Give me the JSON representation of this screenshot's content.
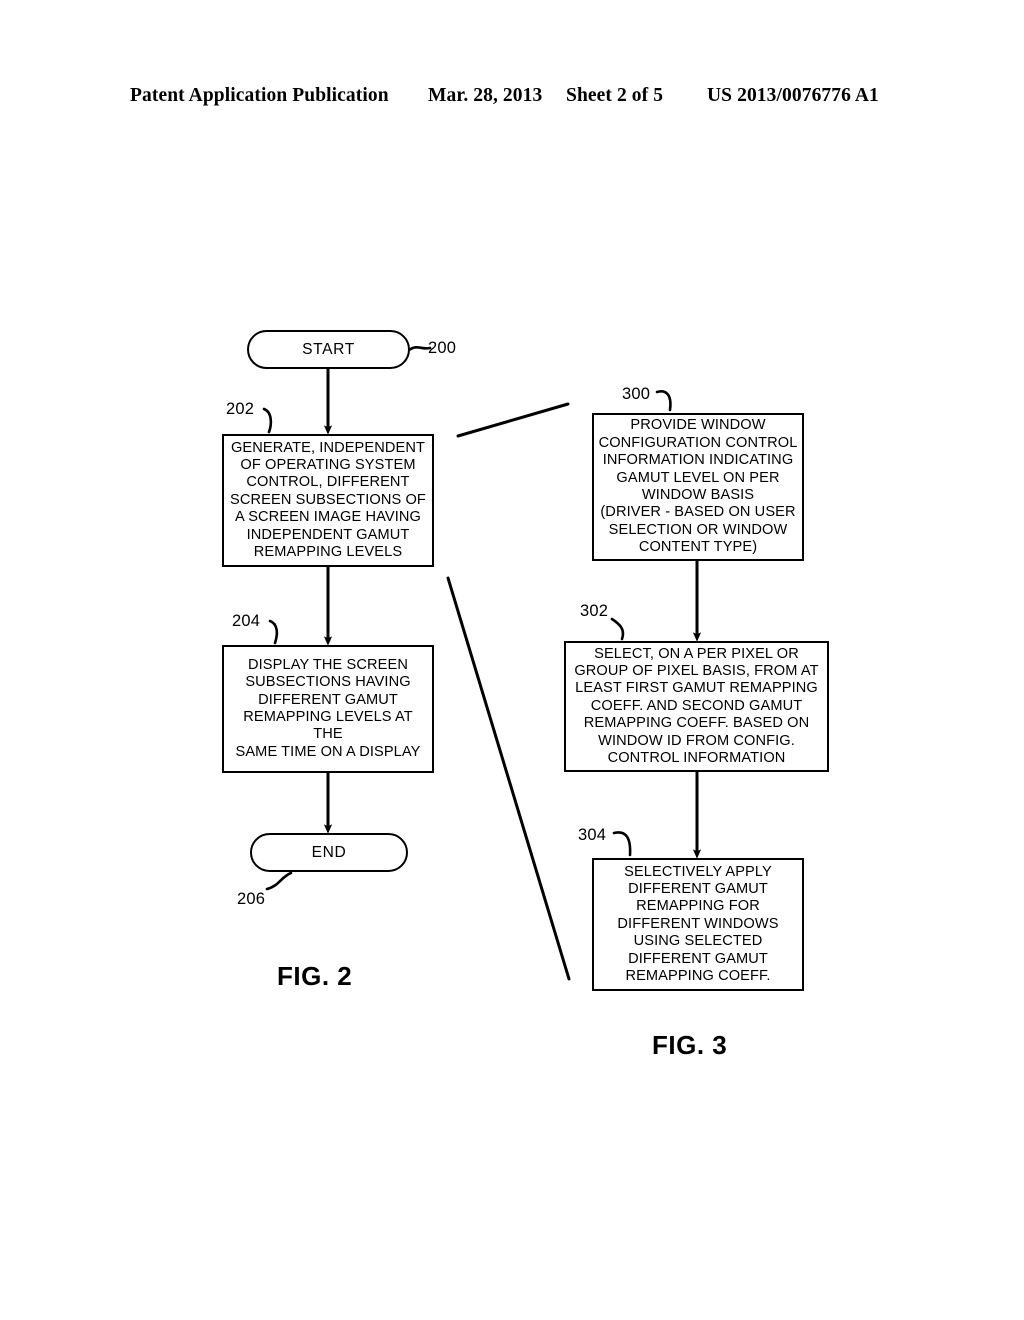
{
  "header": {
    "publication": "Patent Application Publication",
    "date": "Mar. 28, 2013",
    "sheet": "Sheet 2 of 5",
    "patent_number": "US 2013/0076776 A1"
  },
  "figures": [
    {
      "caption": "FIG. 2",
      "nodes": [
        {
          "ref": "200",
          "type": "terminator",
          "label": "START"
        },
        {
          "ref": "202",
          "type": "process",
          "label": "GENERATE, INDEPENDENT\nOF OPERATING SYSTEM\nCONTROL, DIFFERENT\nSCREEN SUBSECTIONS OF\nA SCREEN IMAGE HAVING\nINDEPENDENT GAMUT\nREMAPPING LEVELS"
        },
        {
          "ref": "204",
          "type": "process",
          "label": "DISPLAY THE SCREEN\nSUBSECTIONS HAVING\nDIFFERENT GAMUT\nREMAPPING LEVELS AT THE\nSAME TIME ON A DISPLAY"
        },
        {
          "ref": "206",
          "type": "terminator",
          "label": "END"
        }
      ]
    },
    {
      "caption": "FIG. 3",
      "nodes": [
        {
          "ref": "300",
          "type": "process",
          "label": "PROVIDE WINDOW\nCONFIGURATION CONTROL\nINFORMATION INDICATING\nGAMUT LEVEL ON PER\nWINDOW BASIS\n(DRIVER - BASED ON USER\nSELECTION OR WINDOW\nCONTENT TYPE)"
        },
        {
          "ref": "302",
          "type": "process",
          "label": "SELECT, ON A PER PIXEL OR\nGROUP OF PIXEL BASIS,  FROM AT\nLEAST FIRST GAMUT REMAPPING\nCOEFF. AND SECOND GAMUT\nREMAPPING COEFF. BASED ON\nWINDOW ID FROM CONFIG.\nCONTROL INFORMATION"
        },
        {
          "ref": "304",
          "type": "process",
          "label": "SELECTIVELY APPLY\nDIFFERENT GAMUT\nREMAPPING FOR\nDIFFERENT WINDOWS\nUSING SELECTED\nDIFFERENT GAMUT\nREMAPPING COEFF."
        }
      ]
    }
  ],
  "colors": {
    "ink": "#000000",
    "paper": "#ffffff"
  }
}
